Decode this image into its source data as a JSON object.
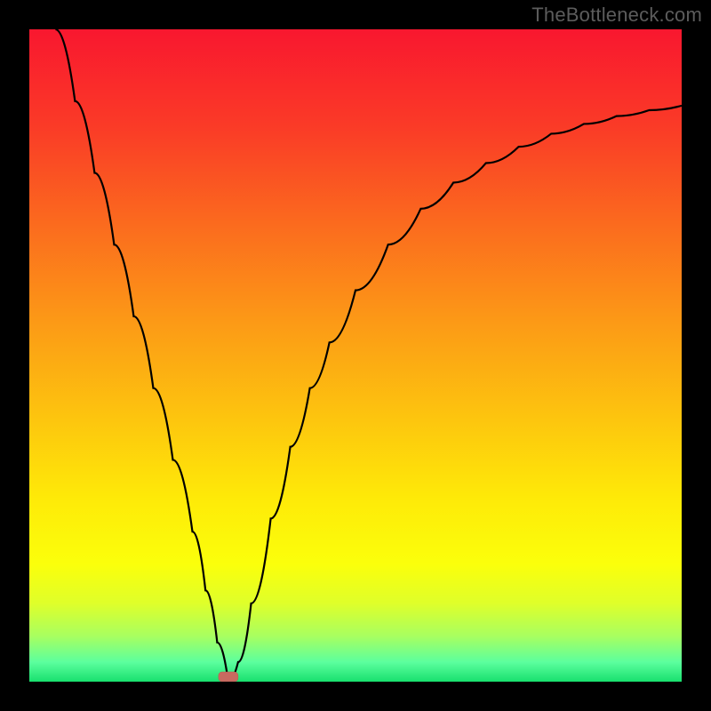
{
  "watermark": "TheBottleneck.com",
  "chart_data": {
    "type": "line",
    "title": "",
    "xlabel": "",
    "ylabel": "",
    "xlim": [
      0,
      100
    ],
    "ylim": [
      0,
      100
    ],
    "grid": false,
    "legend": false,
    "series": [
      {
        "name": "curve",
        "x": [
          4,
          7,
          10,
          13,
          16,
          19,
          22,
          25,
          27,
          28.8,
          30.5,
          32,
          34,
          37,
          40,
          43,
          46,
          50,
          55,
          60,
          65,
          70,
          75,
          80,
          85,
          90,
          95,
          100
        ],
        "y": [
          100,
          89,
          78,
          67,
          56,
          45,
          34,
          23,
          14,
          6,
          0,
          3,
          12,
          25,
          36,
          45,
          52,
          60,
          67,
          72.5,
          76.5,
          79.5,
          82,
          84,
          85.5,
          86.7,
          87.6,
          88.3
        ]
      }
    ],
    "marker": {
      "x": 30.5,
      "y": 0,
      "shape": "rounded-rect"
    },
    "background": {
      "type": "vertical-gradient",
      "stops": [
        {
          "pos": 0.0,
          "color": "#f9172f"
        },
        {
          "pos": 0.15,
          "color": "#fa3b27"
        },
        {
          "pos": 0.3,
          "color": "#fb6b1e"
        },
        {
          "pos": 0.45,
          "color": "#fc9a16"
        },
        {
          "pos": 0.6,
          "color": "#fdc60e"
        },
        {
          "pos": 0.72,
          "color": "#feea08"
        },
        {
          "pos": 0.82,
          "color": "#fbff0b"
        },
        {
          "pos": 0.88,
          "color": "#dfff2a"
        },
        {
          "pos": 0.93,
          "color": "#a8ff60"
        },
        {
          "pos": 0.97,
          "color": "#5cff9e"
        },
        {
          "pos": 1.0,
          "color": "#18e06e"
        }
      ]
    }
  }
}
